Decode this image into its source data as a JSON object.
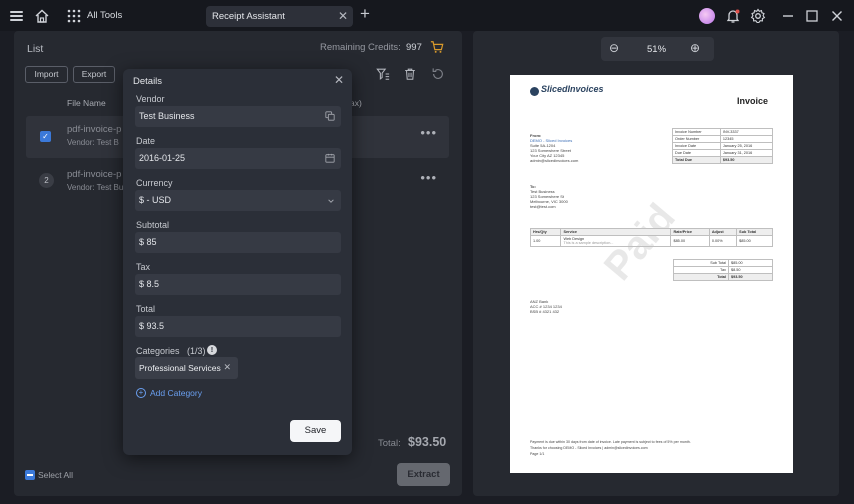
{
  "titlebar": {
    "all_tools_label": "All Tools",
    "tab_label": "Receipt Assistant",
    "tab_close": "✕",
    "tab_add": "+",
    "icons": [
      "menu-icon",
      "home-icon",
      "grid-icon",
      "avatar",
      "bell-icon",
      "gear-icon",
      "minimize-icon",
      "maximize-icon",
      "close-icon"
    ]
  },
  "list": {
    "title": "List",
    "credits_label": "Remaining Credits:",
    "credits_value": "997",
    "import_label": "Import",
    "export_label": "Export",
    "col_filename": "File Name",
    "col_tax": "ax)",
    "rows": [
      {
        "title": "pdf-invoice-p",
        "sub": "Vendor: Test B",
        "more": "•••"
      },
      {
        "index": "2",
        "title": "pdf-invoice-p",
        "sub": "Vendor: Test Bu",
        "more": "•••"
      }
    ],
    "total_label": "Total:",
    "total_value": "$93.50",
    "select_all_label": "Select All",
    "extract_label": "Extract"
  },
  "details": {
    "title": "Details",
    "close": "✕",
    "vendor_label": "Vendor",
    "vendor_value": "Test Business",
    "date_label": "Date",
    "date_value": "2016-01-25",
    "currency_label": "Currency",
    "currency_value": "$ - USD",
    "subtotal_label": "Subtotal",
    "subtotal_value": "$ 85",
    "tax_label": "Tax",
    "tax_value": "$ 8.5",
    "total_label": "Total",
    "total_value": "$ 93.5",
    "categories_label": "Categories",
    "categories_count": "(1/3)",
    "category_chip": "Professional Services",
    "add_category_label": "Add Category",
    "save_label": "Save"
  },
  "preview": {
    "zoom_minus": "⊖",
    "zoom_value": "51%",
    "zoom_plus": "⊕"
  },
  "document": {
    "logo": "SlicedInvoices",
    "heading": "Invoice",
    "watermark": "Paid",
    "from_label": "From:",
    "from_lines": [
      "DEMO - Sliced Invoices",
      "Suite 5A-1204",
      "123 Somewhere Street",
      "Your City AZ 12345",
      "admin@slicedinvoices.com"
    ],
    "meta": [
      [
        "Invoice Number",
        "INV-3337"
      ],
      [
        "Order Number",
        "12345"
      ],
      [
        "Invoice Date",
        "January 25, 2016"
      ],
      [
        "Due Date",
        "January 31, 2016"
      ],
      [
        "Total Due",
        "$93.50"
      ]
    ],
    "to_label": "To:",
    "to_lines": [
      "Test Business",
      "123 Somewhere St",
      "Melbourne, VIC 3000",
      "test@test.com"
    ],
    "items_head": [
      "Hrs/Qty",
      "Service",
      "Rate/Price",
      "Adjust",
      "Sub Total"
    ],
    "item_row": [
      "1.00",
      "Web Design",
      "$85.00",
      "0.00%",
      "$85.00"
    ],
    "item_note": "This is a sample description...",
    "totals": [
      [
        "Sub Total",
        "$85.00"
      ],
      [
        "Tax",
        "$8.50"
      ],
      [
        "Total",
        "$93.50"
      ]
    ],
    "bank_lines": [
      "ANZ Bank",
      "ACC # 1234 1234",
      "BSB # 4321 432"
    ],
    "footer_lines": [
      "Payment is due within 30 days from date of invoice. Late payment is subject to fees of 5% per month.",
      "Thanks for choosing DEMO - Sliced Invoices | admin@slicedinvoices.com",
      "Page 1/1"
    ]
  }
}
